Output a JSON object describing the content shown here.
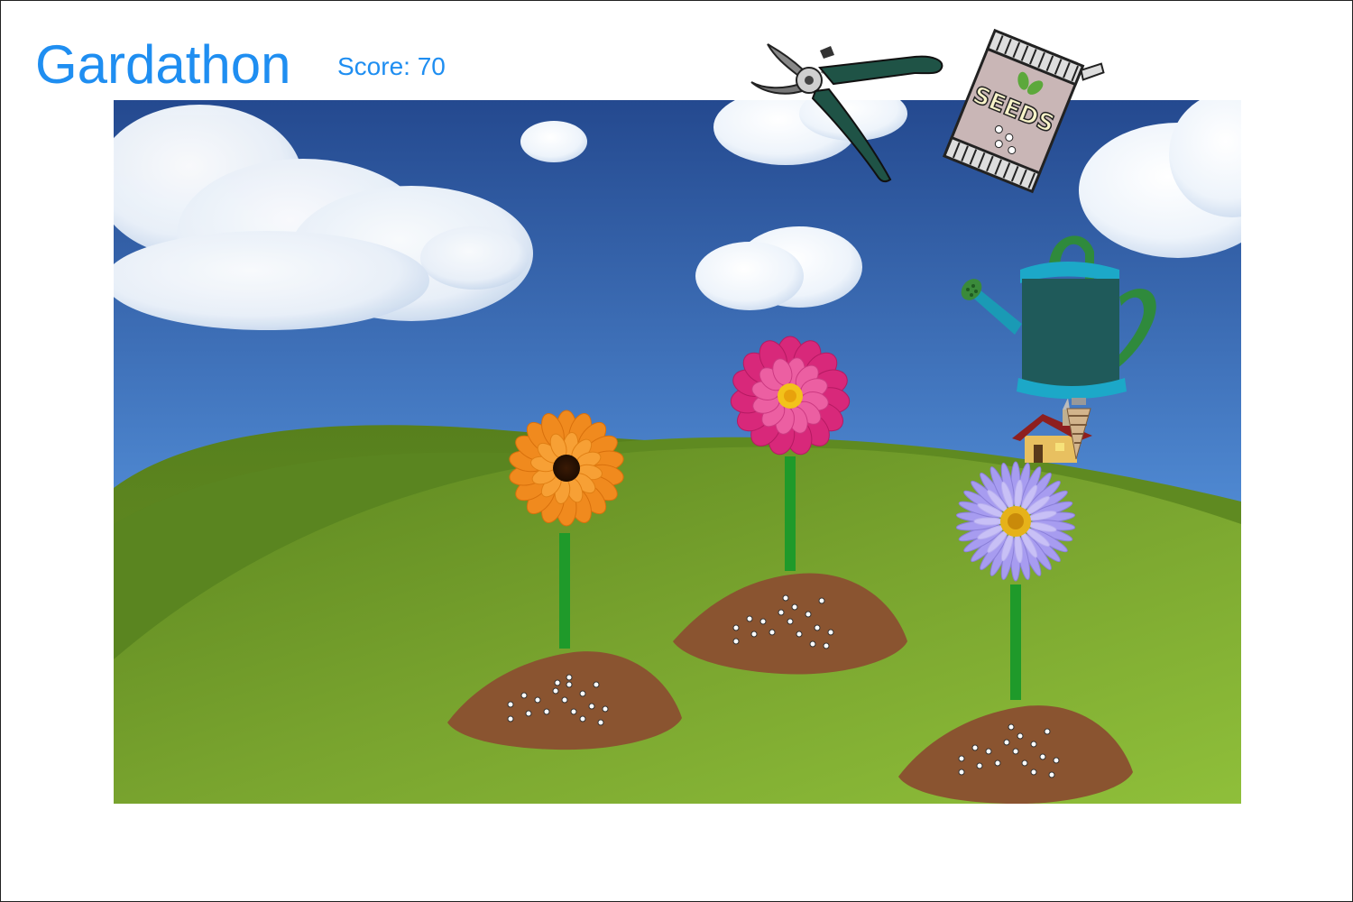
{
  "game": {
    "title": "Gardathon",
    "score_text": "Score: 70"
  },
  "tools": {
    "pruners": {
      "icon": "pruning-shears-icon"
    },
    "seeds": {
      "icon": "seed-packet-icon",
      "label": "SEEDS"
    },
    "watering_can": {
      "icon": "watering-can-icon"
    }
  },
  "flowers": [
    {
      "type": "calendula",
      "color": "#f08a1e"
    },
    {
      "type": "dahlia",
      "color": "#e0408a"
    },
    {
      "type": "aster",
      "color": "#9b90e6"
    }
  ],
  "colors": {
    "title": "#1f8ef1",
    "sky_top": "#2a4f96",
    "sky_bottom": "#6fa6e8",
    "grass": "#6f9b2a",
    "soil": "#8a5430",
    "stem": "#1f9a2a"
  }
}
